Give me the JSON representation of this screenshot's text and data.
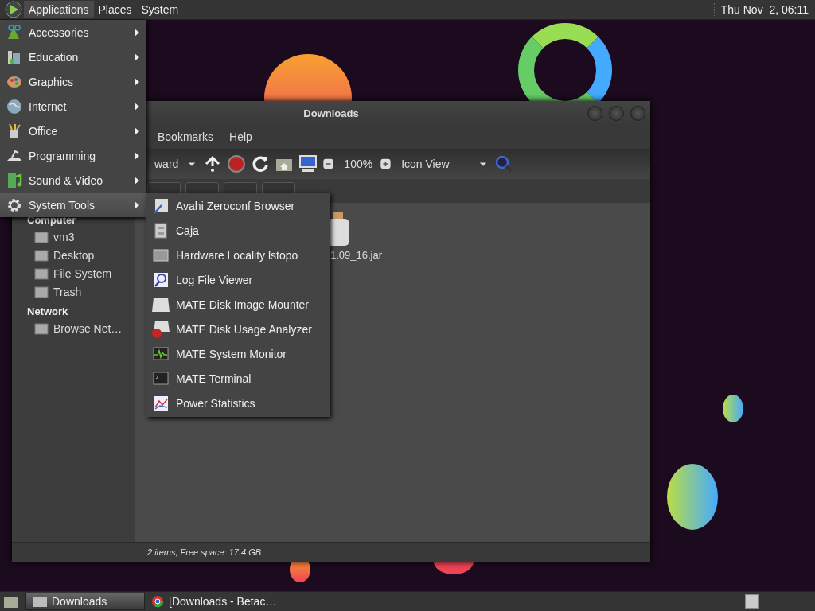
{
  "top_panel": {
    "menus": [
      {
        "label": "Applications",
        "selected": true
      },
      {
        "label": "Places",
        "selected": false
      },
      {
        "label": "System",
        "selected": false
      }
    ],
    "clock": "Thu Nov  2, 06:11"
  },
  "window": {
    "title": "Downloads",
    "menubar": [
      "Bookmarks",
      "Help"
    ],
    "toolbar": {
      "history": "ward",
      "zoom": "100%",
      "view": "Icon View"
    },
    "sidebar": [
      {
        "heading": "Computer",
        "items": [
          "vm3",
          "Desktop",
          "File System",
          "Trash"
        ]
      },
      {
        "heading": "Network",
        "items": [
          "Browse Net…"
        ]
      }
    ],
    "files": [
      {
        "name": "1.09_16.jar"
      }
    ],
    "status": "2 items, Free space: 17.4 GB"
  },
  "applications_menu": [
    {
      "label": "Accessories",
      "selected": false
    },
    {
      "label": "Education",
      "selected": false
    },
    {
      "label": "Graphics",
      "selected": false
    },
    {
      "label": "Internet",
      "selected": false
    },
    {
      "label": "Office",
      "selected": false
    },
    {
      "label": "Programming",
      "selected": false
    },
    {
      "label": "Sound & Video",
      "selected": false
    },
    {
      "label": "System Tools",
      "selected": true
    }
  ],
  "system_tools_menu": [
    "Avahi Zeroconf Browser",
    "Caja",
    "Hardware Locality lstopo",
    "Log File Viewer",
    "MATE Disk Image Mounter",
    "MATE Disk Usage Analyzer",
    "MATE System Monitor",
    "MATE Terminal",
    "Power Statistics"
  ],
  "taskbar": [
    {
      "label": "Downloads",
      "selected": true
    },
    {
      "label": "[Downloads - Betac…",
      "selected": false
    }
  ]
}
